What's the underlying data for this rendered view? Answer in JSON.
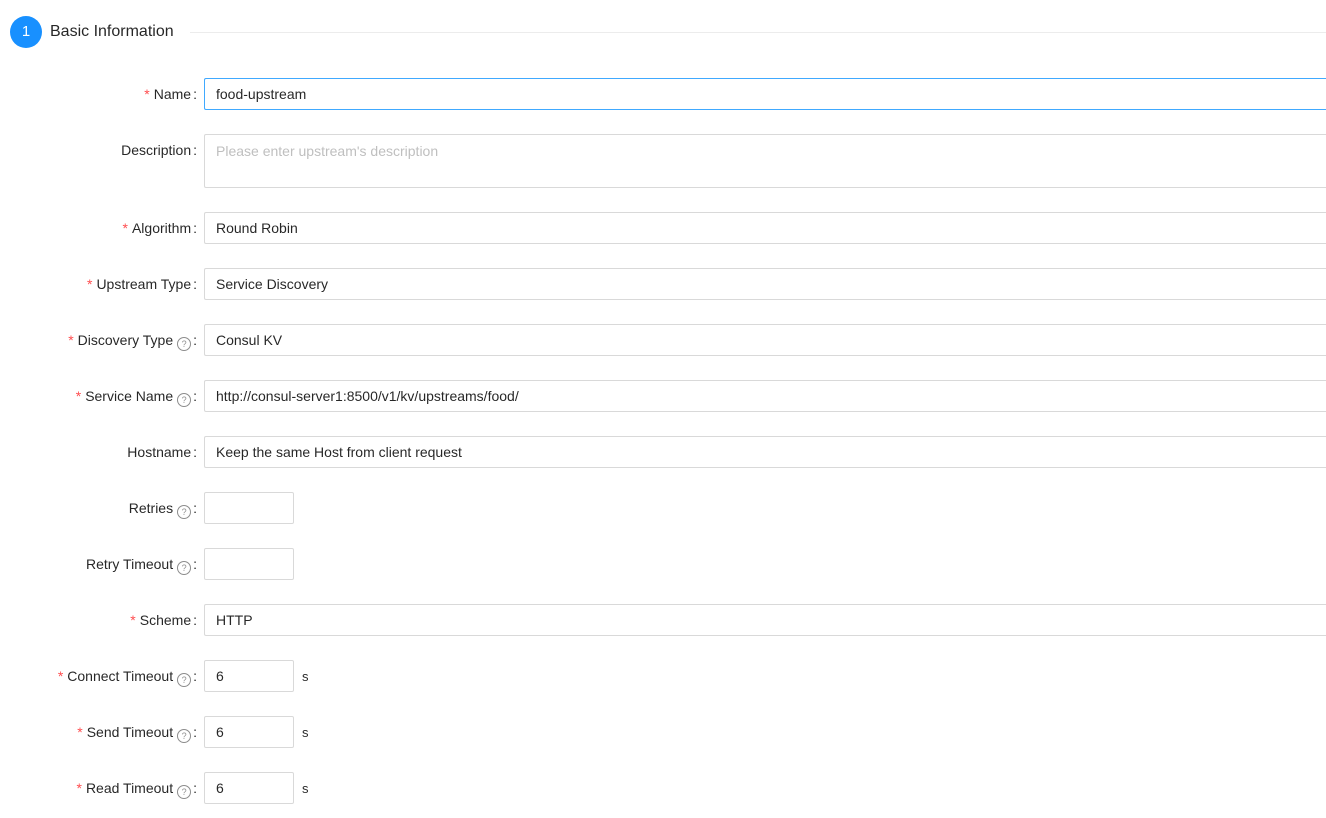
{
  "section": {
    "step": "1",
    "title": "Basic Information"
  },
  "fields": {
    "name": {
      "label": "Name",
      "value": "food-upstream"
    },
    "description": {
      "label": "Description",
      "placeholder": "Please enter upstream's description"
    },
    "algorithm": {
      "label": "Algorithm",
      "value": "Round Robin"
    },
    "upstream_type": {
      "label": "Upstream Type",
      "value": "Service Discovery"
    },
    "discovery_type": {
      "label": "Discovery Type",
      "value": "Consul KV"
    },
    "service_name": {
      "label": "Service Name",
      "value": "http://consul-server1:8500/v1/kv/upstreams/food/"
    },
    "hostname": {
      "label": "Hostname",
      "value": "Keep the same Host from client request"
    },
    "retries": {
      "label": "Retries",
      "value": ""
    },
    "retry_timeout": {
      "label": "Retry Timeout",
      "value": ""
    },
    "scheme": {
      "label": "Scheme",
      "value": "HTTP"
    },
    "connect_timeout": {
      "label": "Connect Timeout",
      "value": "6",
      "unit": "s"
    },
    "send_timeout": {
      "label": "Send Timeout",
      "value": "6",
      "unit": "s"
    },
    "read_timeout": {
      "label": "Read Timeout",
      "value": "6",
      "unit": "s"
    }
  },
  "symbols": {
    "required": "*",
    "help": "?",
    "colon": ":"
  },
  "colors": {
    "accent": "#1890ff",
    "required": "#ff4d4f",
    "border": "#d9d9d9",
    "focus_border": "#40a9ff"
  }
}
